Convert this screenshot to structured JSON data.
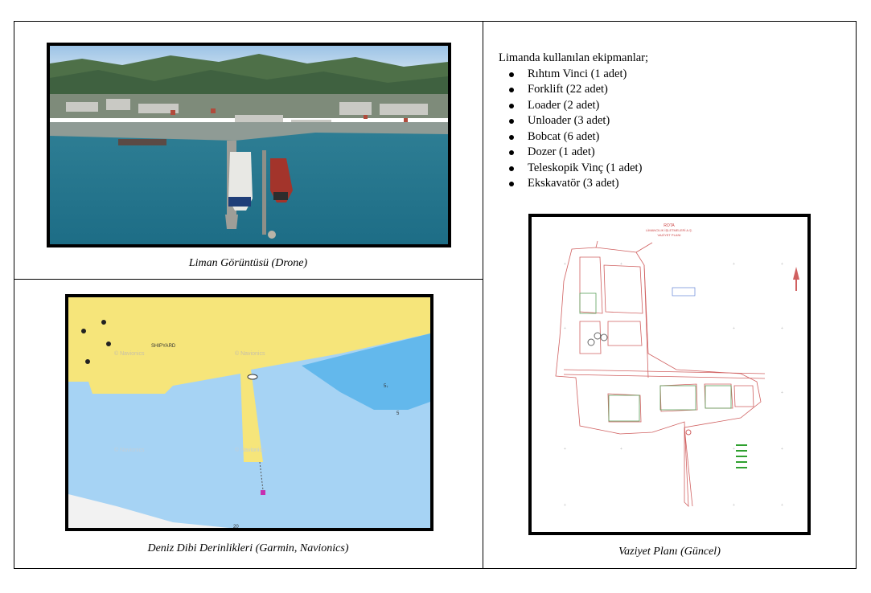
{
  "left_top": {
    "caption": "Liman Görüntüsü (Drone)"
  },
  "left_bottom": {
    "caption": "Deniz Dibi Derinlikleri (Garmin, Navionics)",
    "map_label": "SHIPYARD",
    "watermark": "© Navionics",
    "depth_a": "5₇",
    "depth_b": "5",
    "depth_c": "20"
  },
  "right": {
    "equipment_intro": "Limanda kullanılan ekipmanlar;",
    "equipment": [
      "Rıhtım Vinci (1 adet)",
      "Forklift (22 adet)",
      "Loader (2 adet)",
      "Unloader (3 adet)",
      "Bobcat (6 adet)",
      "Dozer (1 adet)",
      "Teleskopik Vinç (1 adet)",
      "Ekskavatör (3 adet)"
    ],
    "plan_title": "ROTA",
    "plan_subtitle1": "LİMANCILIK İŞLETMELERİ A.Ş.",
    "plan_subtitle2": "VAZİYET PLANI",
    "caption": "Vaziyet Planı (Güncel)"
  }
}
